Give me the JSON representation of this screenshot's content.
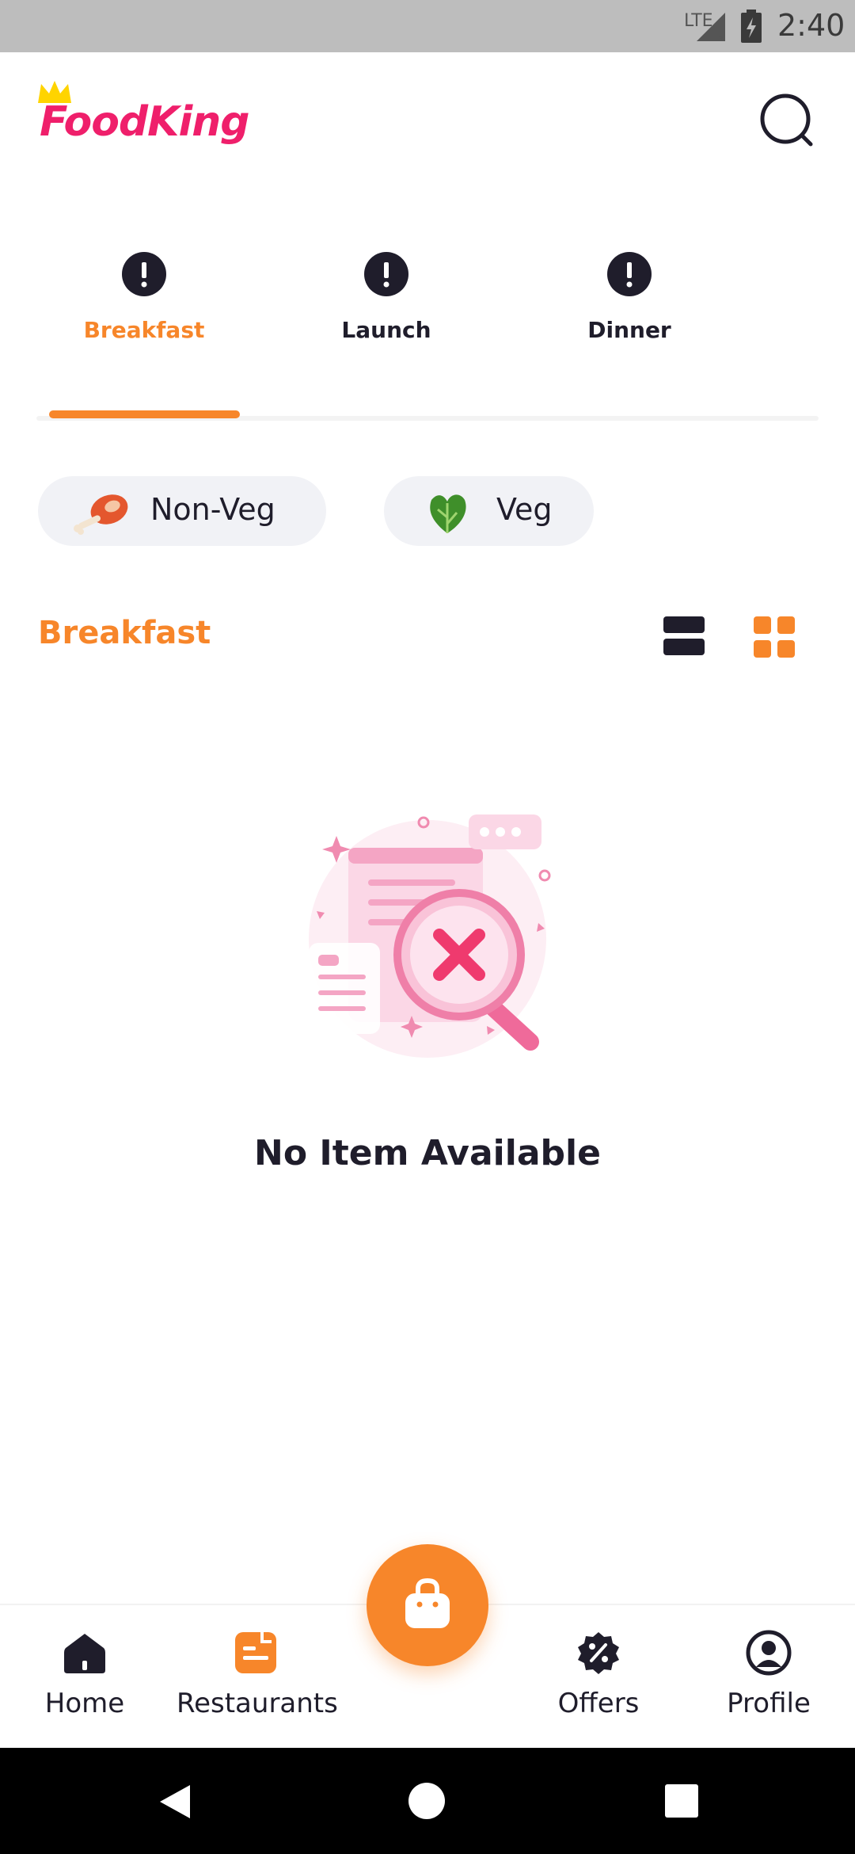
{
  "status_bar": {
    "network": "LTE",
    "time": "2:40"
  },
  "header": {
    "logo_text": "FoodKing",
    "search_icon": "search-icon",
    "brand_color": "#ef1f6b"
  },
  "meal_tabs": {
    "active_index": 0,
    "items": [
      {
        "label": "Breakfast",
        "icon": "alert-circle-icon"
      },
      {
        "label": "Launch",
        "icon": "alert-circle-icon"
      },
      {
        "label": "Dinner",
        "icon": "alert-circle-icon"
      }
    ]
  },
  "filters": {
    "items": [
      {
        "label": "Non-Veg",
        "icon": "meat-drumstick-icon"
      },
      {
        "label": "Veg",
        "icon": "leafy-greens-icon"
      }
    ]
  },
  "section": {
    "title": "Breakfast",
    "view_modes": [
      {
        "icon": "list-view-icon",
        "active": false
      },
      {
        "icon": "grid-view-icon",
        "active": true
      }
    ]
  },
  "empty_state": {
    "illustration": "no-results-magnifier-icon",
    "message": "No Item Available"
  },
  "bottom_nav": {
    "items": [
      {
        "label": "Home",
        "icon": "home-icon"
      },
      {
        "label": "Restaurants",
        "icon": "restaurant-menu-icon"
      },
      {
        "label": "Offers",
        "icon": "discount-badge-icon"
      },
      {
        "label": "Profile",
        "icon": "user-circle-icon"
      }
    ],
    "cart_icon": "shopping-bag-icon"
  },
  "colors": {
    "accent": "#f7862a",
    "text": "#1f1d2b",
    "chip_bg": "#f1f2f6"
  }
}
